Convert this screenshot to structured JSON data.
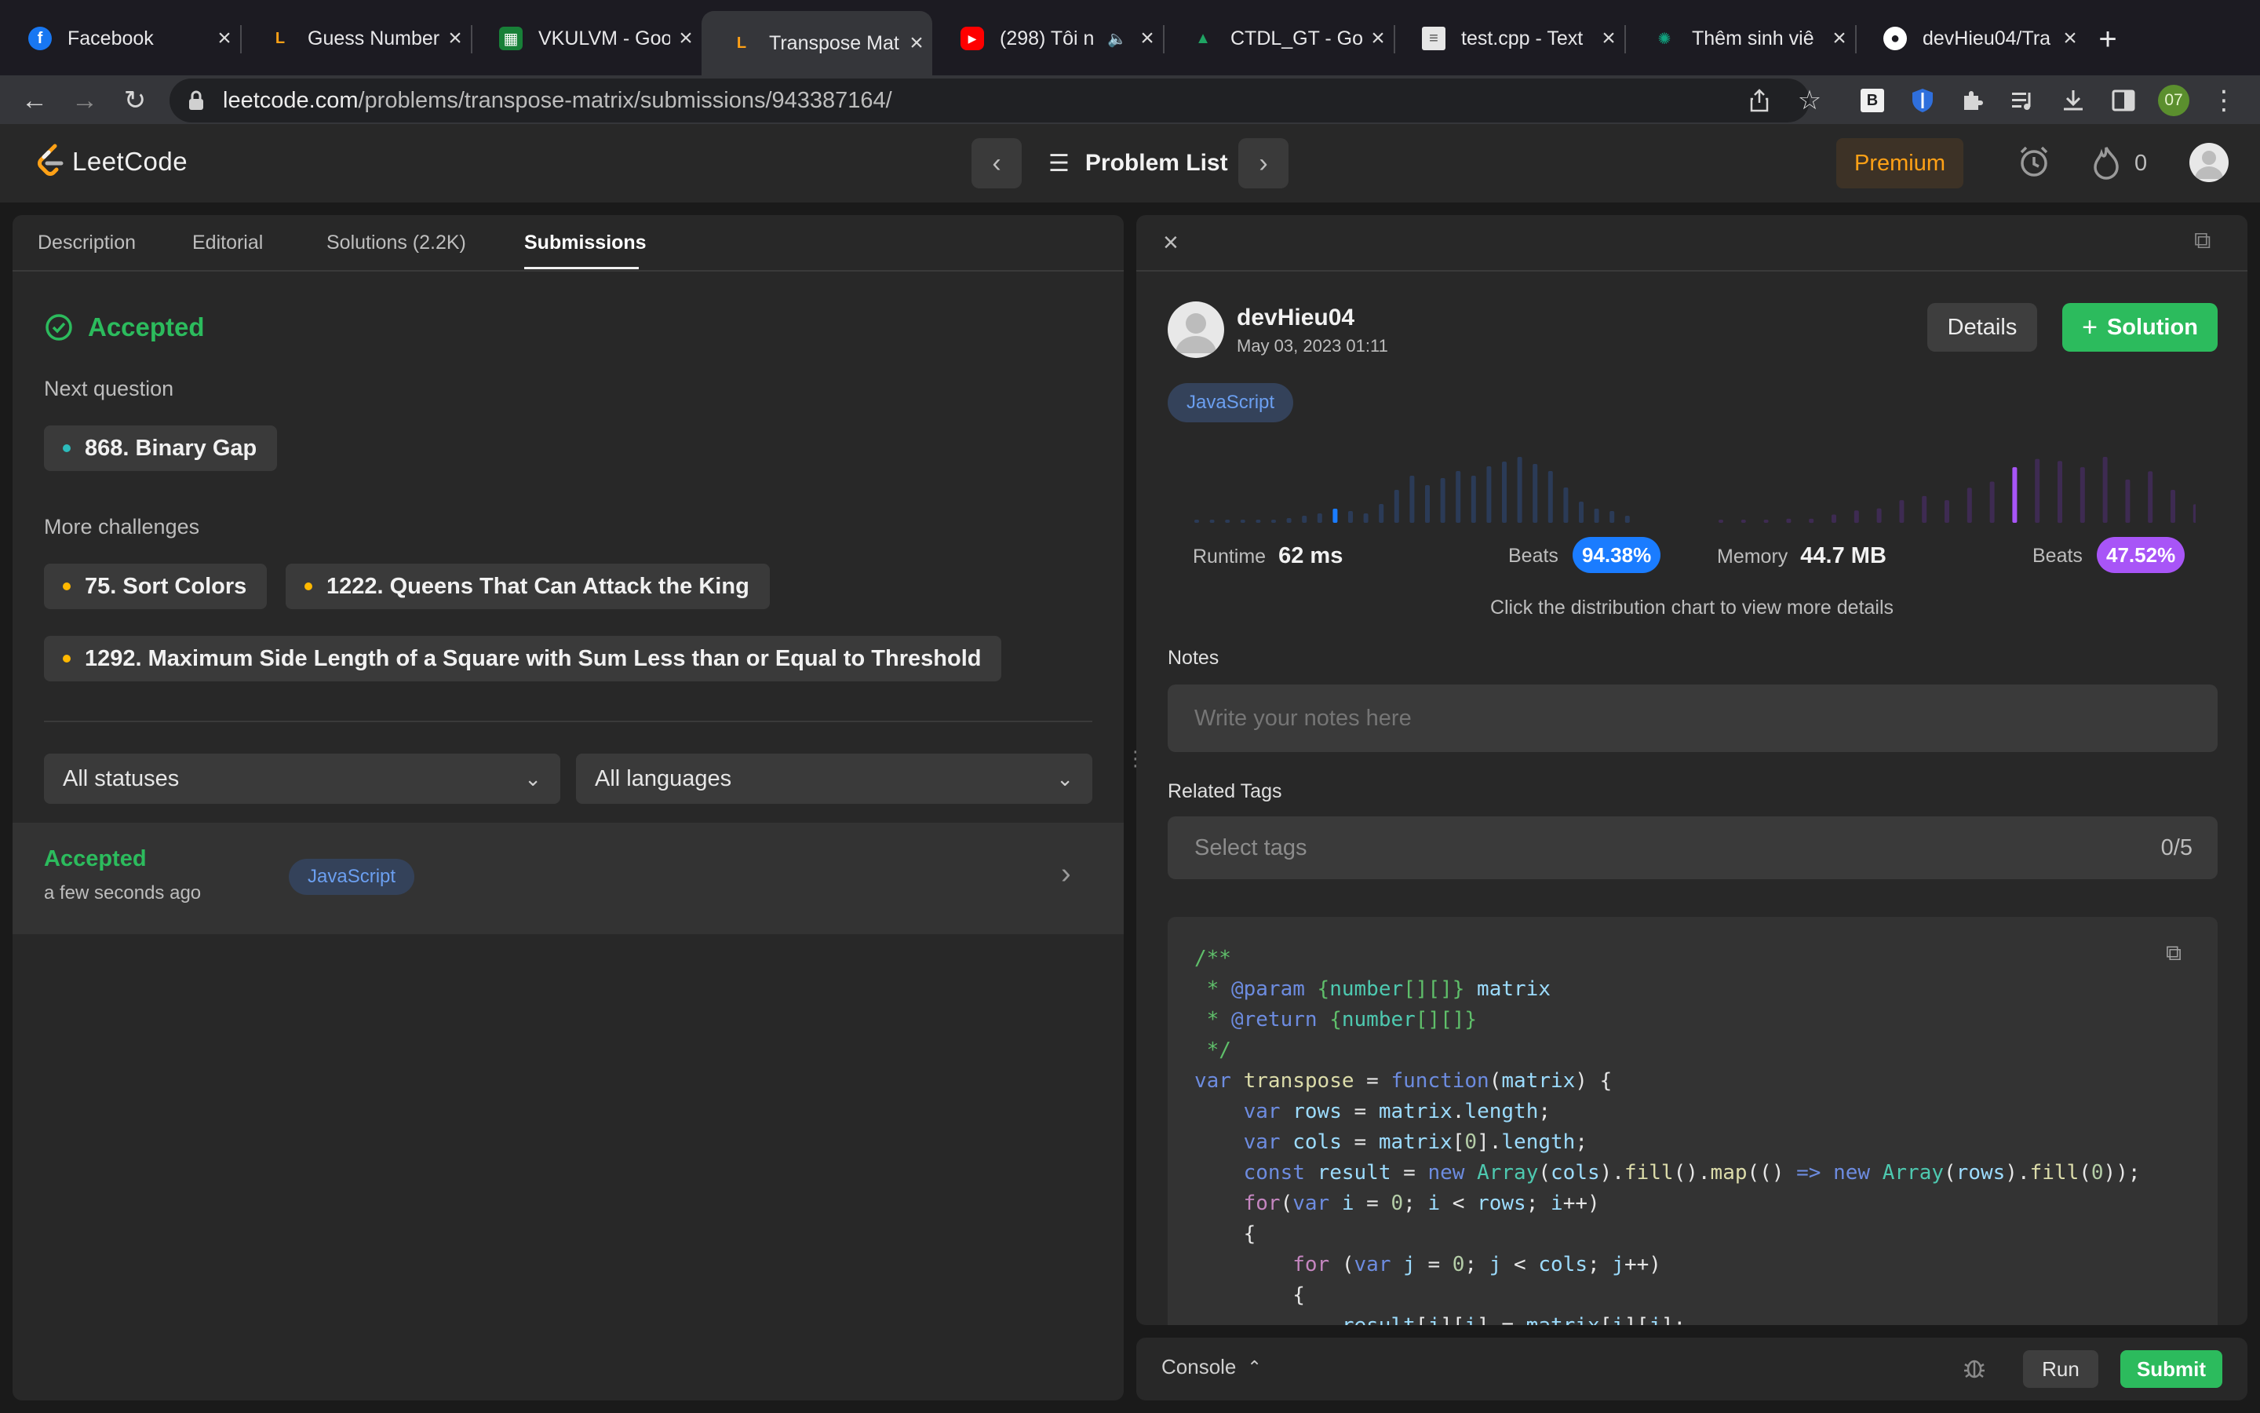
{
  "browser": {
    "tabs": [
      {
        "title": "Facebook",
        "icon": "facebook-icon",
        "color": "#1877f2"
      },
      {
        "title": "Guess Number",
        "icon": "leetcode-icon",
        "color": "#ffa116"
      },
      {
        "title": "VKULVM - Goo",
        "icon": "google-sheets-icon",
        "color": "#188038"
      },
      {
        "title": "Transpose Mat",
        "icon": "leetcode-icon",
        "color": "#ffa116"
      },
      {
        "title": "(298) Tôi n",
        "icon": "youtube-icon",
        "color": "#ff0000"
      },
      {
        "title": "CTDL_GT - Go",
        "icon": "google-drive-icon",
        "color": "#1fa463"
      },
      {
        "title": "test.cpp - Text",
        "icon": "document-icon",
        "color": "#9aa0a6"
      },
      {
        "title": "Thêm sinh viê",
        "icon": "openai-icon",
        "color": "#10a37f"
      },
      {
        "title": "devHieu04/Tra",
        "icon": "github-icon",
        "color": "#ffffff"
      }
    ],
    "new_tab": "+",
    "url_host": "leetcode.com",
    "url_path": "/problems/transpose-matrix/submissions/943387164/",
    "profile_badge": "07"
  },
  "nav": {
    "logo_text": "LeetCode",
    "problem_list": "Problem List",
    "premium": "Premium",
    "streak_count": "0"
  },
  "left": {
    "tabs": [
      "Description",
      "Editorial",
      "Solutions (2.2K)",
      "Submissions"
    ],
    "status": "Accepted",
    "next_question_label": "Next question",
    "next_question": "868. Binary Gap",
    "more_challenges_label": "More challenges",
    "challenges": [
      "75. Sort Colors",
      "1222. Queens That Can Attack the King",
      "1292. Maximum Side Length of a Square with Sum Less than or Equal to Threshold"
    ],
    "filter_status": "All statuses",
    "filter_language": "All languages",
    "submission": {
      "status": "Accepted",
      "time": "a few seconds ago",
      "language": "JavaScript"
    }
  },
  "right": {
    "user": {
      "name": "devHieu04",
      "date": "May 03, 2023 01:11"
    },
    "details_btn": "Details",
    "solution_btn": "Solution",
    "language": "JavaScript",
    "runtime": {
      "label": "Runtime",
      "value": "62 ms",
      "beats_label": "Beats",
      "beats": "94.38%"
    },
    "memory": {
      "label": "Memory",
      "value": "44.7 MB",
      "beats_label": "Beats",
      "beats": "47.52%"
    },
    "hint": "Click the distribution chart to view more details",
    "notes_label": "Notes",
    "notes_placeholder": "Write your notes here",
    "tags_label": "Related Tags",
    "tags_placeholder": "Select tags",
    "tags_count": "0/5"
  },
  "chart_data": [
    {
      "type": "bar",
      "series": [
        {
          "values": [
            1,
            1,
            1,
            1,
            1,
            1,
            2,
            3,
            4,
            6,
            5,
            4,
            8,
            14,
            20,
            16,
            19,
            22,
            20,
            24,
            26,
            28,
            25,
            22,
            15,
            9,
            6,
            5,
            3
          ]
        }
      ],
      "highlight_index": 9
    },
    {
      "type": "bar",
      "series": [
        {
          "values": [
            1,
            1,
            1,
            2,
            2,
            4,
            6,
            7,
            11,
            13,
            11,
            17,
            20,
            27,
            31,
            30,
            27,
            32,
            21,
            25,
            16,
            9
          ]
        }
      ],
      "highlight_index": 13
    }
  ],
  "console": {
    "label": "Console",
    "run": "Run",
    "submit": "Submit"
  }
}
